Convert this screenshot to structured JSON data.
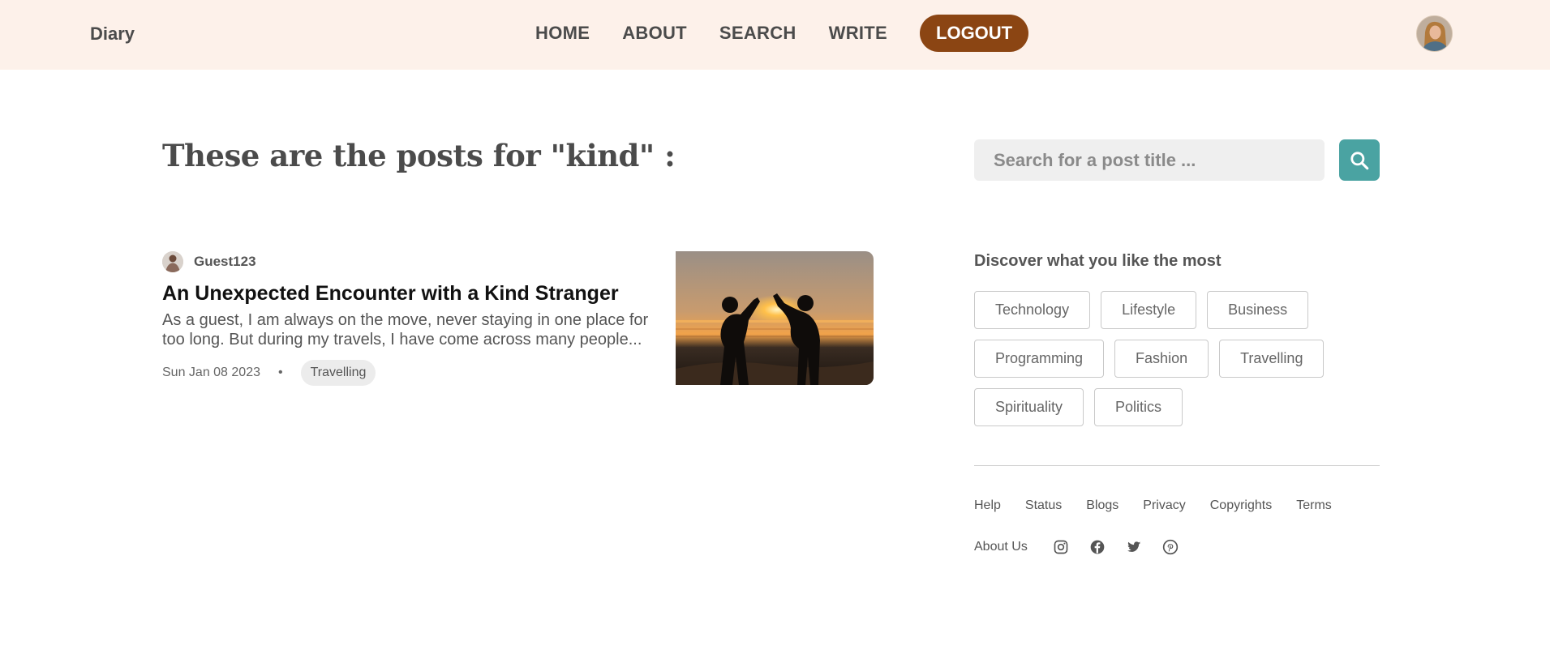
{
  "header": {
    "brand": "Diary",
    "nav": [
      "HOME",
      "ABOUT",
      "SEARCH",
      "WRITE"
    ],
    "logout_label": "LOGOUT"
  },
  "main": {
    "heading": "These are the posts for \"kind\" :",
    "posts": [
      {
        "author": "Guest123",
        "title": "An Unexpected Encounter with a Kind Stranger",
        "excerpt": "As a guest, I am always on the move, never staying in one place for too long. But during my travels, I have come across many people...",
        "date": "Sun Jan 08 2023",
        "separator": "•",
        "tag": "Travelling"
      }
    ]
  },
  "search": {
    "placeholder": "Search for a post title ..."
  },
  "sidebar": {
    "discover_title": "Discover what you like the most",
    "tags": [
      "Technology",
      "Lifestyle",
      "Business",
      "Programming",
      "Fashion",
      "Travelling",
      "Spirituality",
      "Politics"
    ]
  },
  "footer": {
    "links": [
      "Help",
      "Status",
      "Blogs",
      "Privacy",
      "Copyrights",
      "Terms"
    ],
    "about": "About Us",
    "social": [
      "instagram-icon",
      "facebook-icon",
      "twitter-icon",
      "pinterest-icon"
    ]
  },
  "colors": {
    "header_bg": "#fdf1ea",
    "logout_bg": "#8b4513",
    "search_button_bg": "#4aa3a2"
  }
}
